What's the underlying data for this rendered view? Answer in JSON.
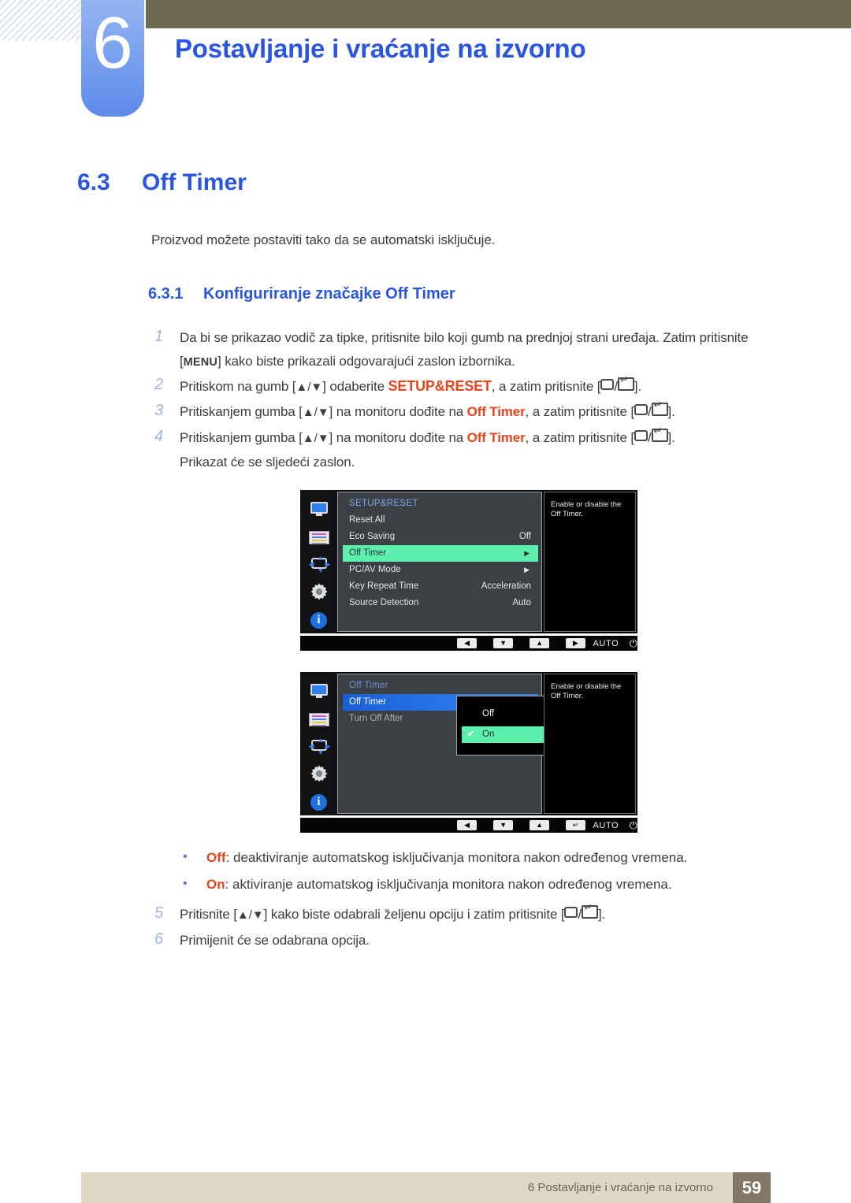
{
  "header": {
    "chapter_number": "6",
    "chapter_title": "Postavljanje i vraćanje na izvorno"
  },
  "section": {
    "number": "6.3",
    "title": "Off Timer",
    "intro": "Proizvod možete postaviti tako da se automatski isključuje.",
    "sub_number": "6.3.1",
    "sub_title": "Konfiguriranje značajke Off Timer"
  },
  "steps": {
    "s1_num": "1",
    "s1_a": "Da bi se prikazao vodič za tipke, pritisnite bilo koji gumb na prednjoj strani uređaja. Zatim pritisnite",
    "s1_menu": "MENU",
    "s1_b": "] kako biste prikazali odgovarajući zaslon izbornika.",
    "s1_open": "[",
    "s2_num": "2",
    "s2_a": "Pritiskom na gumb [",
    "s2_keys": "▲/▼",
    "s2_b": "] odaberite ",
    "s2_kw": "SETUP&RESET",
    "s2_c": ", a zatim pritisnite [",
    "s2_d": "].",
    "s3_num": "3",
    "s3_a": "Pritiskanjem gumba [",
    "s3_keys": "▲/▼",
    "s3_b": "] na monitoru dođite na ",
    "s3_kw": "Off Timer",
    "s3_c": ", a zatim pritisnite [",
    "s3_d": "].",
    "s4_num": "4",
    "s4_a": "Pritiskanjem gumba [",
    "s4_keys": "▲/▼",
    "s4_b": "] na monitoru dođite na ",
    "s4_kw": "Off Timer",
    "s4_c": ", a zatim pritisnite [",
    "s4_d": "].",
    "s4_note": "Prikazat će se sljedeći zaslon.",
    "s5_num": "5",
    "s5_a": "Pritisnite [",
    "s5_keys": "▲/▼",
    "s5_b": "] kako biste odabrali željenu opciju i zatim pritisnite [",
    "s5_c": "].",
    "s6_num": "6",
    "s6_text": "Primijenit će se odabrana opcija."
  },
  "bullets": [
    {
      "dot": "•",
      "kw": "Off",
      "text": ": deaktiviranje automatskog isključivanja monitora nakon određenog vremena."
    },
    {
      "dot": "•",
      "kw": "On",
      "text": ": aktiviranje automatskog isključivanja monitora nakon određenog vremena."
    }
  ],
  "osd1": {
    "title": "SETUP&RESET",
    "rows": [
      {
        "label": "Reset All",
        "value": ""
      },
      {
        "label": "Eco Saving",
        "value": "Off"
      },
      {
        "label": "Off Timer",
        "value": "",
        "arrow": "▶",
        "selected": true
      },
      {
        "label": "PC/AV Mode",
        "value": "",
        "arrow": "▶"
      },
      {
        "label": "Key Repeat Time",
        "value": "Acceleration"
      },
      {
        "label": "Source Detection",
        "value": "Auto"
      }
    ],
    "description": "Enable or disable the Off Timer.",
    "bar": {
      "left": "◀",
      "down": "▼",
      "up": "▲",
      "fourth": "▶",
      "auto": "AUTO",
      "power": "⏻"
    }
  },
  "osd2": {
    "title": "Off Timer",
    "rows": [
      {
        "label": "Off Timer",
        "selected_blue": true
      },
      {
        "label": "Turn Off After",
        "dim": true
      }
    ],
    "popup": {
      "options": [
        {
          "label": "Off",
          "checked": false
        },
        {
          "label": "On",
          "checked": true,
          "check": "✔"
        }
      ]
    },
    "description": "Enable or disable the Off Timer.",
    "bar": {
      "left": "◀",
      "down": "▼",
      "up": "▲",
      "fourth": "↵",
      "auto": "AUTO",
      "power": "⏻"
    }
  },
  "icons": {
    "monitor": "monitor-icon",
    "picture": "picture-color-icon",
    "size": "size-position-icon",
    "gear": "gear-icon",
    "info": "info-icon",
    "info_glyph": "i",
    "gear_glyph": "✷"
  },
  "footer": {
    "text": "6 Postavljanje i vraćanje na izvorno",
    "page": "59"
  },
  "colors": {
    "accent_blue": "#2a55e0",
    "keyword_red": "#e8441c",
    "osd_green": "#5cf0ae",
    "osd_blue": "#2f7ef2",
    "olive": "#6e6a54",
    "footer": "#ddd8c6"
  }
}
